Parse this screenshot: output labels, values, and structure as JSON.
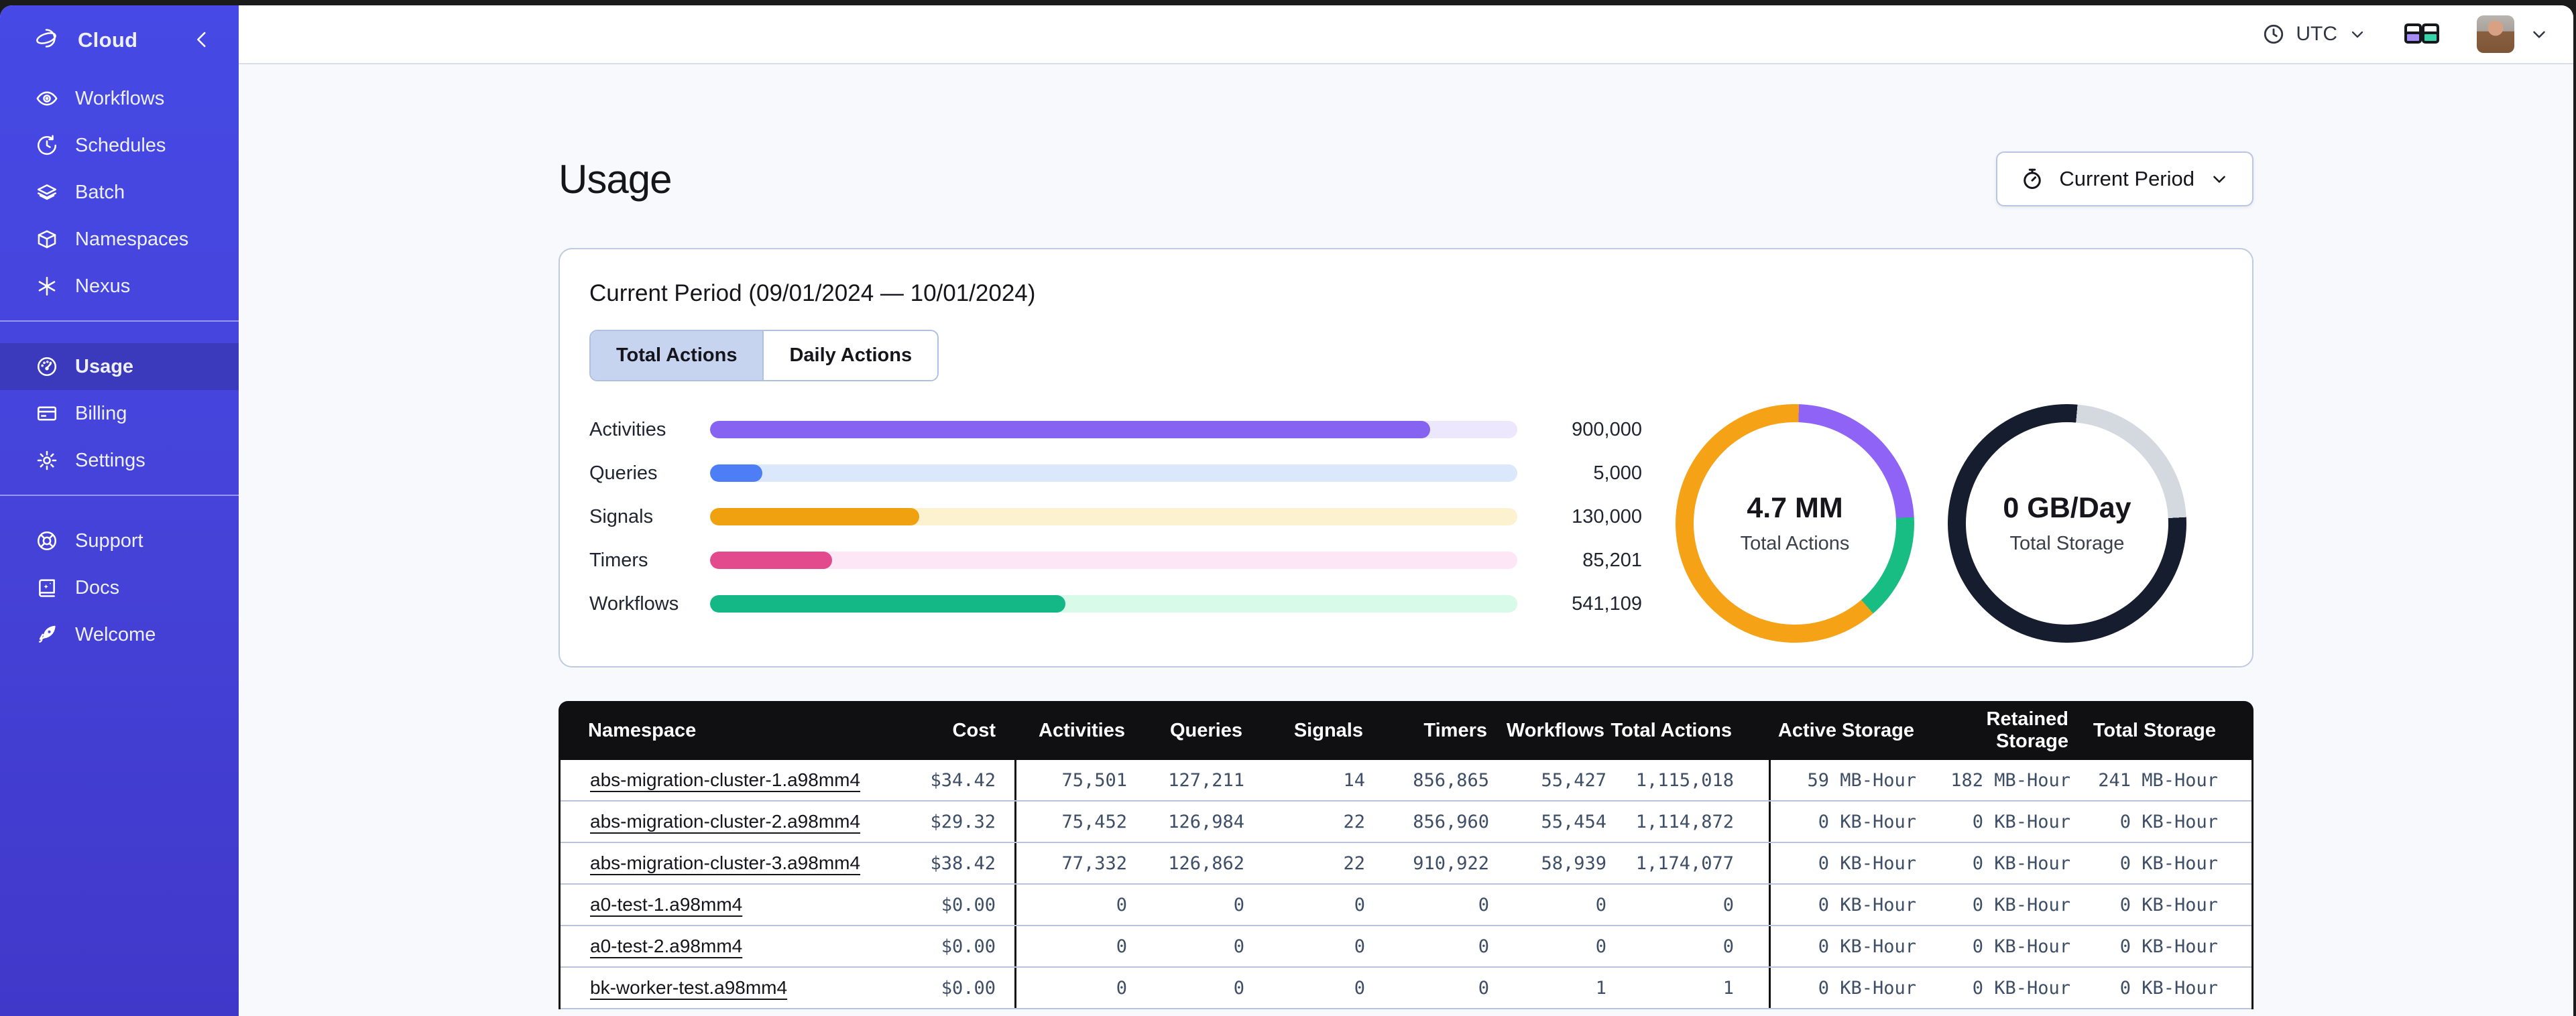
{
  "topbar": {
    "timezone": {
      "label": "UTC"
    }
  },
  "sidebar": {
    "brand": "Cloud",
    "groups": [
      {
        "items": [
          {
            "label": "Workflows",
            "icon": "eye-icon"
          },
          {
            "label": "Schedules",
            "icon": "clock-icon"
          },
          {
            "label": "Batch",
            "icon": "layers-icon"
          },
          {
            "label": "Namespaces",
            "icon": "box-icon"
          },
          {
            "label": "Nexus",
            "icon": "asterisk-icon"
          }
        ]
      },
      {
        "items": [
          {
            "label": "Usage",
            "icon": "gauge-icon",
            "active": true
          },
          {
            "label": "Billing",
            "icon": "credit-card-icon"
          },
          {
            "label": "Settings",
            "icon": "gear-icon"
          }
        ]
      },
      {
        "items": [
          {
            "label": "Support",
            "icon": "life-buoy-icon"
          },
          {
            "label": "Docs",
            "icon": "book-icon"
          },
          {
            "label": "Welcome",
            "icon": "rocket-icon"
          }
        ]
      }
    ]
  },
  "page": {
    "title": "Usage",
    "period_button": "Current Period"
  },
  "panel": {
    "title": "Current Period (09/01/2024 — 10/01/2024)",
    "tabs": [
      {
        "label": "Total Actions",
        "active": true
      },
      {
        "label": "Daily Actions",
        "active": false
      }
    ],
    "bars": [
      {
        "label": "Activities",
        "value": "900,000",
        "pct": "89.2"
      },
      {
        "label": "Queries",
        "value": "5,000",
        "pct": "6.5"
      },
      {
        "label": "Signals",
        "value": "130,000",
        "pct": "25.9"
      },
      {
        "label": "Timers",
        "value": "85,201",
        "pct": "15.1"
      },
      {
        "label": "Workflows",
        "value": "541,109",
        "pct": "44.0"
      }
    ],
    "donuts": [
      {
        "value": "4.7 MM",
        "label": "Total Actions",
        "segments": [
          {
            "color": "#f5a217",
            "start": 0,
            "end": 2
          },
          {
            "color": "#8f63f5",
            "start": 2,
            "end": 87
          },
          {
            "color": "#18bd84",
            "start": 87,
            "end": 139
          },
          {
            "color": "#f5a217",
            "start": 139,
            "end": 360
          }
        ]
      },
      {
        "value": "0 GB/Day",
        "label": "Total Storage",
        "segments": [
          {
            "color": "#161d2e",
            "start": 0,
            "end": 5
          },
          {
            "color": "#d4d8df",
            "start": 5,
            "end": 87
          },
          {
            "color": "#161d2e",
            "start": 87,
            "end": 360
          }
        ]
      }
    ]
  },
  "chart_data": [
    {
      "type": "bar",
      "title": "Total Actions by type",
      "categories": [
        "Activities",
        "Queries",
        "Signals",
        "Timers",
        "Workflows"
      ],
      "values": [
        900000,
        5000,
        130000,
        85201,
        541109
      ],
      "fill_percent": [
        89.2,
        6.5,
        25.9,
        15.1,
        44.0
      ],
      "colors": [
        "#8763f2",
        "#4d7ef5",
        "#f0a10f",
        "#e3498d",
        "#14b886"
      ]
    },
    {
      "type": "pie",
      "title": "Total Actions",
      "center_value": "4.7 MM",
      "slices_deg": [
        {
          "color": "#8f63f5",
          "deg": 85
        },
        {
          "color": "#18bd84",
          "deg": 52
        },
        {
          "color": "#f5a217",
          "deg": 223
        }
      ]
    },
    {
      "type": "pie",
      "title": "Total Storage",
      "center_value": "0 GB/Day",
      "slices_deg": [
        {
          "color": "#d4d8df",
          "deg": 82
        },
        {
          "color": "#161d2e",
          "deg": 278
        }
      ]
    }
  ],
  "table": {
    "columns": [
      "Namespace",
      "Cost",
      "Activities",
      "Queries",
      "Signals",
      "Timers",
      "Workflows",
      "Total Actions",
      "Active Storage",
      "Retained Storage",
      "Total Storage"
    ],
    "rows": [
      {
        "cells": [
          "abs-migration-cluster-1.a98mm4",
          "$34.42",
          "75,501",
          "127,211",
          "14",
          "856,865",
          "55,427",
          "1,115,018",
          "59 MB-Hour",
          "182 MB-Hour",
          "241 MB-Hour"
        ]
      },
      {
        "cells": [
          "abs-migration-cluster-2.a98mm4",
          "$29.32",
          "75,452",
          "126,984",
          "22",
          "856,960",
          "55,454",
          "1,114,872",
          "0 KB-Hour",
          "0 KB-Hour",
          "0 KB-Hour"
        ]
      },
      {
        "cells": [
          "abs-migration-cluster-3.a98mm4",
          "$38.42",
          "77,332",
          "126,862",
          "22",
          "910,922",
          "58,939",
          "1,174,077",
          "0 KB-Hour",
          "0 KB-Hour",
          "0 KB-Hour"
        ]
      },
      {
        "cells": [
          "a0-test-1.a98mm4",
          "$0.00",
          "0",
          "0",
          "0",
          "0",
          "0",
          "0",
          "0 KB-Hour",
          "0 KB-Hour",
          "0 KB-Hour"
        ]
      },
      {
        "cells": [
          "a0-test-2.a98mm4",
          "$0.00",
          "0",
          "0",
          "0",
          "0",
          "0",
          "0",
          "0 KB-Hour",
          "0 KB-Hour",
          "0 KB-Hour"
        ]
      },
      {
        "cells": [
          "bk-worker-test.a98mm4",
          "$0.00",
          "0",
          "0",
          "0",
          "0",
          "1",
          "1",
          "0 KB-Hour",
          "0 KB-Hour",
          "0 KB-Hour"
        ]
      }
    ]
  }
}
